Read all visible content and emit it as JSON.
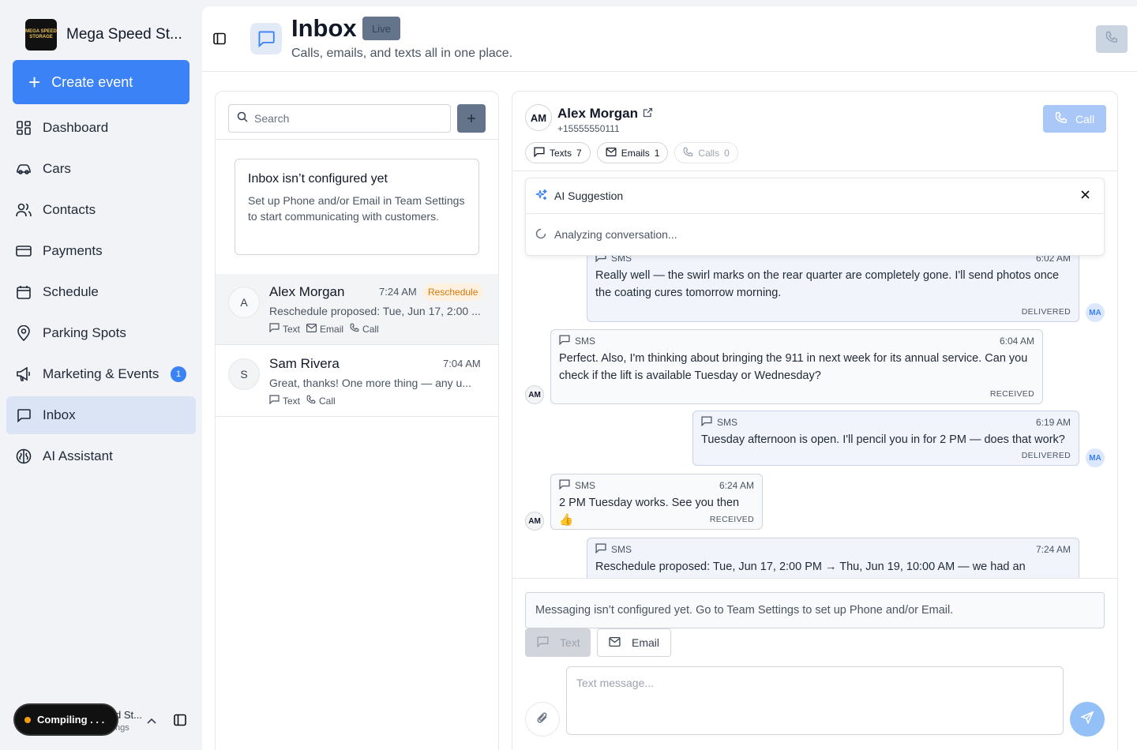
{
  "brand": {
    "name": "Mega Speed St...",
    "logo_text": "MEGA SPEED STORAGE"
  },
  "sidebar": {
    "create_label": "Create event",
    "items": [
      {
        "label": "Dashboard",
        "icon": "dashboard-icon"
      },
      {
        "label": "Cars",
        "icon": "car-icon"
      },
      {
        "label": "Contacts",
        "icon": "contacts-icon"
      },
      {
        "label": "Payments",
        "icon": "payments-icon"
      },
      {
        "label": "Schedule",
        "icon": "calendar-icon"
      },
      {
        "label": "Parking Spots",
        "icon": "map-pin-icon"
      },
      {
        "label": "Marketing & Events",
        "icon": "megaphone-icon",
        "badge": "1"
      },
      {
        "label": "Inbox",
        "icon": "inbox-icon",
        "active": true
      },
      {
        "label": "AI Assistant",
        "icon": "brain-icon"
      }
    ],
    "footer": {
      "name": "d St...",
      "sub": "ngs",
      "compiling": "Compiling . . ."
    }
  },
  "header": {
    "title": "Inbox",
    "badge": "Live",
    "subtitle": "Calls, emails, and texts all in one place."
  },
  "list": {
    "search_placeholder": "Search",
    "notice": {
      "title": "Inbox isn’t configured yet",
      "text": "Set up Phone and/or Email in Team Settings to start communicating with customers."
    },
    "conversations": [
      {
        "initial": "A",
        "name": "Alex Morgan",
        "time": "7:24 AM",
        "tag": "Reschedule",
        "preview": "Reschedule proposed: Tue, Jun 17, 2:00 ...",
        "channels": [
          "Text",
          "Email",
          "Call"
        ],
        "selected": true
      },
      {
        "initial": "S",
        "name": "Sam Rivera",
        "time": "7:04 AM",
        "preview": "Great, thanks! One more thing — any u...",
        "channels": [
          "Text",
          "Call"
        ]
      }
    ]
  },
  "thread": {
    "contact": {
      "initials": "AM",
      "name": "Alex Morgan",
      "phone": "+15555550111"
    },
    "call_label": "Call",
    "chips": [
      {
        "label": "Texts",
        "count": "7"
      },
      {
        "label": "Emails",
        "count": "1"
      },
      {
        "label": "Calls",
        "count": "0"
      }
    ],
    "ai": {
      "title": "AI Suggestion",
      "status": "Analyzing conversation..."
    },
    "messages": [
      {
        "dir": "out",
        "channel": "SMS",
        "time": "6:02 AM",
        "text": "Really well — the swirl marks on the rear quarter are completely gone. I'll send photos once the coating cures tomorrow morning.",
        "status": "DELIVERED",
        "avatar": "MA"
      },
      {
        "dir": "in",
        "channel": "SMS",
        "time": "6:04 AM",
        "text": "Perfect. Also, I'm thinking about bringing the 911 in next week for its annual service. Can you check if the lift is available Tuesday or Wednesday?",
        "status": "RECEIVED",
        "avatar": "AM"
      },
      {
        "dir": "out",
        "channel": "SMS",
        "time": "6:19 AM",
        "text": "Tuesday afternoon is open. I'll pencil you in for 2 PM — does that work?",
        "status": "DELIVERED",
        "avatar": "MA"
      },
      {
        "dir": "in",
        "channel": "SMS",
        "time": "6:24 AM",
        "text": "2 PM Tuesday works. See you then 👍",
        "status": "RECEIVED",
        "avatar": "AM"
      },
      {
        "dir": "out",
        "channel": "SMS",
        "time": "7:24 AM",
        "text": "Reschedule proposed: Tue, Jun 17, 2:00 PM → Thu, Jun 19, 10:00 AM — we had an emergency intake that conflicts with the lift schedule. Happy to move you to Thursday.",
        "status": "",
        "avatar": ""
      }
    ],
    "composer": {
      "notice": "Messaging isn’t configured yet. Go to Team Settings to set up Phone and/or Email.",
      "text_tab": "Text",
      "email_tab": "Email",
      "placeholder": "Text message..."
    }
  }
}
